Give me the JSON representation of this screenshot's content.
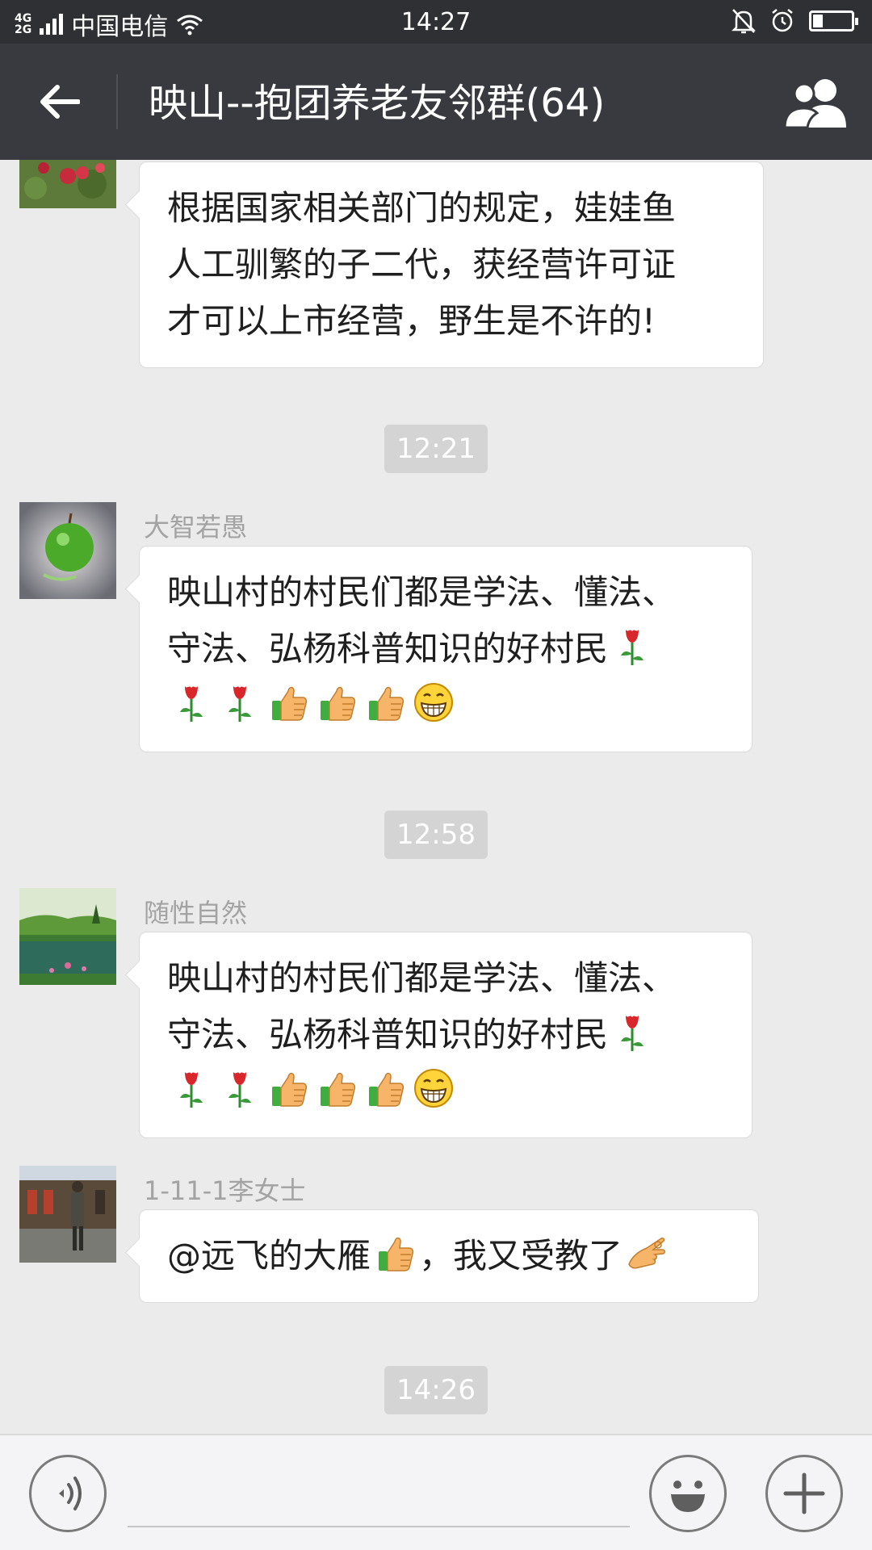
{
  "status_bar": {
    "network_top": "4G",
    "network_bottom": "2G",
    "carrier": "中国电信",
    "time": "14:27",
    "battery_level": 0.25
  },
  "header": {
    "back_icon": "arrow-left-icon",
    "title": "映山--抱团养老友邻群(64)",
    "members_icon": "group-members-icon"
  },
  "messages": [
    {
      "sender": "",
      "avatar": "rose-flowers-photo",
      "lines": [
        "根据国家相关部门的规定，娃娃鱼",
        "人工驯繁的子二代，获经营许可证",
        "才可以上市经营，野生是不许的!"
      ]
    },
    {
      "timestamp": "12:21"
    },
    {
      "sender": "大智若愚",
      "avatar": "green-apple-photo",
      "lines": [
        "映山村的村民们都是学法、懂法、",
        "守法、弘杨科普知识的好村民"
      ],
      "emoji": [
        "rose",
        "rose",
        "rose",
        "thumbs-up",
        "thumbs-up",
        "thumbs-up",
        "grin"
      ]
    },
    {
      "timestamp": "12:58"
    },
    {
      "sender": "随性自然",
      "avatar": "lake-landscape-photo",
      "lines": [
        "映山村的村民们都是学法、懂法、",
        "守法、弘杨科普知识的好村民"
      ],
      "emoji": [
        "rose",
        "rose",
        "rose",
        "thumbs-up",
        "thumbs-up",
        "thumbs-up",
        "grin"
      ]
    },
    {
      "sender": "1-11-1李女士",
      "avatar": "person-standing-photo",
      "text_before": "@远飞的大雁",
      "text_after": "，我又受教了",
      "emoji": [
        "thumbs-up",
        "ok-hand"
      ]
    },
    {
      "timestamp": "14:26"
    }
  ],
  "input_bar": {
    "voice_icon": "voice-icon",
    "input_value": "",
    "emoji_icon": "emoji-icon",
    "plus_icon": "plus-icon"
  },
  "colors": {
    "status_bar_bg": "#2f3033",
    "title_bar_bg": "#393a3f",
    "chat_bg": "#ebebeb",
    "bubble_bg": "#ffffff",
    "timestamp_bg": "#d4d4d4",
    "sender_text": "#a3a3a3"
  }
}
